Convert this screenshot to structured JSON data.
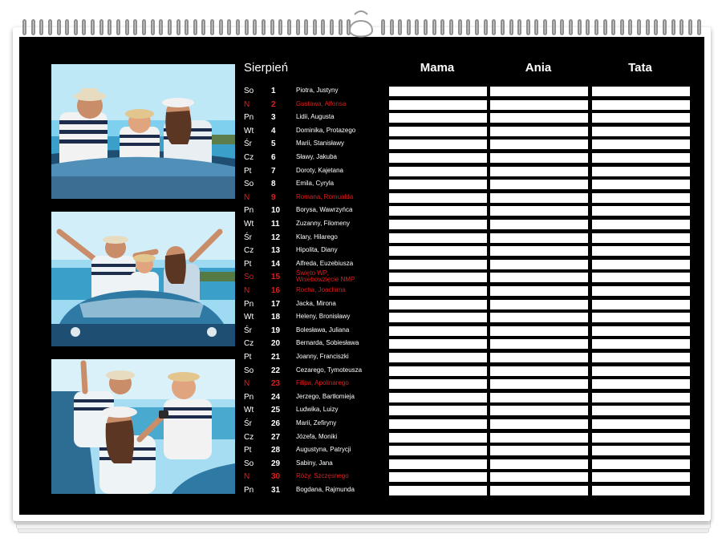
{
  "calendar": {
    "month": "Sierpień",
    "columns": [
      "Mama",
      "Ania",
      "Tata"
    ],
    "days": [
      {
        "name": "So",
        "num": "1",
        "names": "Piotra, Justyny",
        "holiday": false
      },
      {
        "name": "N",
        "num": "2",
        "names": "Gustawa, Alfonsa",
        "holiday": true
      },
      {
        "name": "Pn",
        "num": "3",
        "names": "Lidii, Augusta",
        "holiday": false
      },
      {
        "name": "Wt",
        "num": "4",
        "names": "Dominika, Protazego",
        "holiday": false
      },
      {
        "name": "Śr",
        "num": "5",
        "names": "Marii, Stanisławy",
        "holiday": false
      },
      {
        "name": "Cz",
        "num": "6",
        "names": "Sławy, Jakuba",
        "holiday": false
      },
      {
        "name": "Pt",
        "num": "7",
        "names": "Doroty, Kajetana",
        "holiday": false
      },
      {
        "name": "So",
        "num": "8",
        "names": "Emila, Cyryla",
        "holiday": false
      },
      {
        "name": "N",
        "num": "9",
        "names": "Romana, Romualda",
        "holiday": true
      },
      {
        "name": "Pn",
        "num": "10",
        "names": "Borysa, Wawrzyńca",
        "holiday": false
      },
      {
        "name": "Wt",
        "num": "11",
        "names": "Zuzanny, Filomeny",
        "holiday": false
      },
      {
        "name": "Śr",
        "num": "12",
        "names": "Klary, Hilarego",
        "holiday": false
      },
      {
        "name": "Cz",
        "num": "13",
        "names": "Hipolita, Diany",
        "holiday": false
      },
      {
        "name": "Pt",
        "num": "14",
        "names": "Alfreda, Euzebiusza",
        "holiday": false
      },
      {
        "name": "So",
        "num": "15",
        "names": "Święto WP, Wniebowzięcie NMP",
        "holiday": true
      },
      {
        "name": "N",
        "num": "16",
        "names": "Rocha, Joachima",
        "holiday": true
      },
      {
        "name": "Pn",
        "num": "17",
        "names": "Jacka, Mirona",
        "holiday": false
      },
      {
        "name": "Wt",
        "num": "18",
        "names": "Heleny, Bronisławy",
        "holiday": false
      },
      {
        "name": "Śr",
        "num": "19",
        "names": "Bolesława, Juliana",
        "holiday": false
      },
      {
        "name": "Cz",
        "num": "20",
        "names": "Bernarda, Sobiesława",
        "holiday": false
      },
      {
        "name": "Pt",
        "num": "21",
        "names": "Joanny, Franciszki",
        "holiday": false
      },
      {
        "name": "So",
        "num": "22",
        "names": "Cezarego, Tymoteusza",
        "holiday": false
      },
      {
        "name": "N",
        "num": "23",
        "names": "Filipa, Apolinarego",
        "holiday": true
      },
      {
        "name": "Pn",
        "num": "24",
        "names": "Jerzego, Bartłomieja",
        "holiday": false
      },
      {
        "name": "Wt",
        "num": "25",
        "names": "Ludwika, Luizy",
        "holiday": false
      },
      {
        "name": "Śr",
        "num": "26",
        "names": "Marii, Zefiryny",
        "holiday": false
      },
      {
        "name": "Cz",
        "num": "27",
        "names": "Józefa, Moniki",
        "holiday": false
      },
      {
        "name": "Pt",
        "num": "28",
        "names": "Augustyna, Patrycji",
        "holiday": false
      },
      {
        "name": "So",
        "num": "29",
        "names": "Sabiny, Jana",
        "holiday": false
      },
      {
        "name": "N",
        "num": "30",
        "names": "Róży, Szczęsnego",
        "holiday": true
      },
      {
        "name": "Pn",
        "num": "31",
        "names": "Bogdana, Rajmunda",
        "holiday": false
      }
    ]
  },
  "colors": {
    "sheet": "#000000",
    "holiday_red": "#e01e1e",
    "text": "#ffffff",
    "cell": "#ffffff"
  },
  "photos": [
    {
      "subject": "family-in-convertible-photo"
    },
    {
      "subject": "family-cheering-in-convertible-photo"
    },
    {
      "subject": "family-selfie-in-convertible-photo"
    }
  ]
}
